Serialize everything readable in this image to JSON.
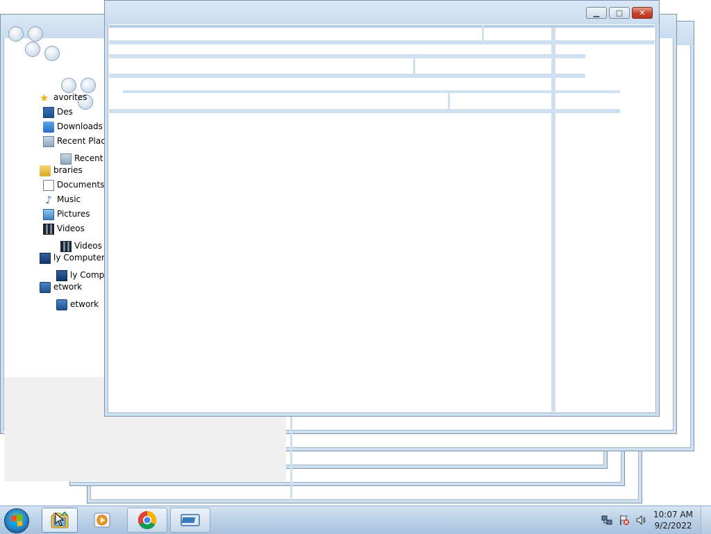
{
  "explorer": {
    "nav_items": [
      {
        "label": "avorites",
        "icon": "star-icon"
      },
      {
        "label": "Des",
        "icon": "desktop-icon"
      },
      {
        "label": "Downloads",
        "icon": "downloads-icon"
      },
      {
        "label": "Recent Places",
        "icon": "recent-places-icon"
      },
      {
        "label": "braries",
        "icon": "libraries-icon"
      },
      {
        "label": "Documents",
        "icon": "documents-icon"
      },
      {
        "label": "Music",
        "icon": "music-icon"
      },
      {
        "label": "Pictures",
        "icon": "pictures-icon"
      },
      {
        "label": "Videos",
        "icon": "videos-icon"
      },
      {
        "label": "ly Computer",
        "icon": "computer-icon"
      },
      {
        "label": "etwork",
        "icon": "network-icon"
      }
    ],
    "nav_items_back": [
      {
        "label": "Recent I",
        "icon": "recent-places-icon"
      },
      {
        "label": "Videos",
        "icon": "videos-icon"
      },
      {
        "label": "ly Comp",
        "icon": "computer-icon"
      },
      {
        "label": "etwork",
        "icon": "network-icon"
      }
    ]
  },
  "window": {
    "minimize_glyph": "▁",
    "maximize_glyph": "□",
    "close_glyph": "✕"
  },
  "taskbar": {
    "start_label": "Start",
    "pinned": [
      {
        "name": "windows-explorer",
        "icon": "explorer-icon",
        "active": true
      },
      {
        "name": "media-player",
        "icon": "media-player-icon",
        "active": false
      },
      {
        "name": "chrome",
        "icon": "chrome-icon",
        "active": false
      },
      {
        "name": "app",
        "icon": "window-app-icon",
        "active": false
      }
    ],
    "tray": {
      "network_icon": "network-tray-icon",
      "flag_icon": "action-center-icon",
      "volume_icon": "volume-icon"
    },
    "clock": {
      "time": "10:07 AM",
      "date": "9/2/2022"
    }
  }
}
